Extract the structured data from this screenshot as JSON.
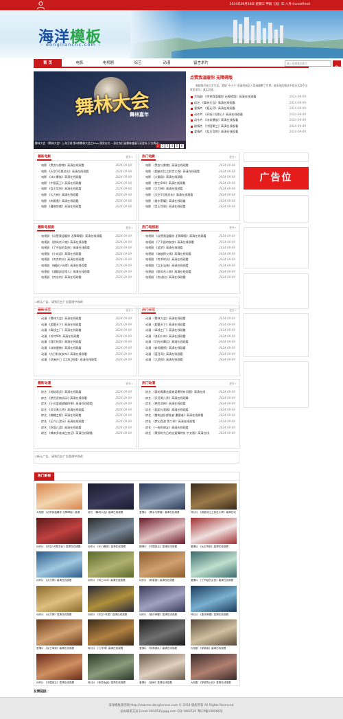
{
  "topbar": {
    "date_text": "2024年09月18日 星期三 甲辰【龙】年 八月十undefined",
    "user_icon": "user-icon",
    "bg": "#c81a1a"
  },
  "header": {
    "logo_part1": "海洋",
    "logo_part2": "模板",
    "domain": "- dongliancnc.com -"
  },
  "nav": {
    "items": [
      "首 页",
      "电影",
      "电视剧",
      "综艺",
      "动漫",
      "留言求片"
    ],
    "active": 0,
    "search_placeholder": "输入你想看的影片",
    "search_icon": "search-icon"
  },
  "banner": {
    "caption": "舞林大会  《舞林大会》上海卫视 第8期舞林大会之Miss 颁奖仪式 一身红衣打造舞林盛宴闪亮登场 只为舞动...",
    "title_art": "舞林大会",
    "sub_art": "舞林嘉年",
    "dots": [
      "1",
      "2",
      "3",
      "4",
      "5",
      "6"
    ],
    "active_dot": 0
  },
  "hot": {
    "title": "点赞我温暖你 无障碍版",
    "desc": "美剧简开始大学生涯。就被“不小子”圣诞的街区人用画翻覆了世界。被未地而情浓不穿无法穿不当家里很可。真实其他...",
    "items": [
      {
        "text": "大陆剧 《余把我温暖你 无障碍版》高清在线观看",
        "date": "2024-09-09"
      },
      {
        "text": "综艺 《舞林大会》高清在线观看",
        "date": "2024-09-09"
      },
      {
        "text": "爱情片 《爱无尽》高清在线观看",
        "date": "2024-09-09"
      },
      {
        "text": "动作片 《开始1号愿心》高清在线观看",
        "date": "2024-09-09"
      },
      {
        "text": "动作片 《冰封暴族》高清在线观看",
        "date": "2024-09-09"
      },
      {
        "text": "剧情片 《中国第三》高清在线观看",
        "date": "2024-09-09"
      },
      {
        "text": "爱情片 《女王驾到》高清在线观看",
        "date": "2024-09-09"
      }
    ]
  },
  "more_label": "更多+",
  "ad_text": "新认广告，请到后台广告管理中修改",
  "ad_position": "广告位",
  "box_latest_movie": {
    "title": "最新电影",
    "items": [
      {
        "text": "电影 《黑女与野兽》高清在线观看",
        "date": "2024-09-08"
      },
      {
        "text": "电影 《天空1号愿总化》高清在线观看",
        "date": "2024-09-08"
      },
      {
        "text": "电影 《冰川暴族》高清在线观看",
        "date": "2024-09-08"
      },
      {
        "text": "电影 《中国英王》高清在线观看",
        "date": "2024-09-08"
      },
      {
        "text": "电影 《女王驾到》高清在线观看",
        "date": "2024-09-08"
      },
      {
        "text": "电影 《大力神》高清在线观看",
        "date": "2024-09-08"
      },
      {
        "text": "电影 《刺客奥》高清在线观看",
        "date": "2024-09-08"
      },
      {
        "text": "电影 《暮夜惊魂》高清在线观看",
        "date": "2024-09-08"
      }
    ]
  },
  "box_hot_movie": {
    "title": "热门电影",
    "items": [
      {
        "text": "电影 《黑女与野兽》高清在线观看",
        "date": "2024-09-08"
      },
      {
        "text": "电影 《超越对比之前世大哥》高清在线观看",
        "date": "2024-09-08"
      },
      {
        "text": "电影 《大翻身》高清在线观看",
        "date": "2024-09-08"
      },
      {
        "text": "电影 《特工008》高清在线观看",
        "date": "2024-09-08"
      },
      {
        "text": "电影 《大力神》高清在线观看",
        "date": "2024-09-08"
      },
      {
        "text": "电影 《天空1号愿总化》高清在线观看",
        "date": "2024-09-08"
      },
      {
        "text": "电影 《首尔荣耀》高清在线观看",
        "date": "2024-09-08"
      },
      {
        "text": "电影 《女王驾到》高清在线观看",
        "date": "2024-09-08"
      }
    ]
  },
  "box_latest_tv": {
    "title": "最新电视剧",
    "items": [
      {
        "text": "电视剧 《点赞我温暖你 无障碍版》高清在线观看",
        "date": "2024-09-09"
      },
      {
        "text": "电视剧 《欧风杰人物》高清在线观看",
        "date": "2024-09-09"
      },
      {
        "text": "电视剧 《了不起的女侠》高清在线观看",
        "date": "2024-09-09"
      },
      {
        "text": "电视剧 《小欢迎》高清在线观看",
        "date": "2024-09-09"
      },
      {
        "text": "电视剧 《杰克的光》高清在线观看",
        "date": "2024-09-09"
      },
      {
        "text": "电视剧 《蛹缺少天使》高清在线观看",
        "date": "2024-09-09"
      },
      {
        "text": "电视剧 《潘都部会馆儿》高清在线观看",
        "date": "2024-09-09"
      },
      {
        "text": "电视剧 《传吉利》高清在线观看",
        "date": "2024-09-09"
      }
    ]
  },
  "box_hot_tv": {
    "title": "热门电视剧",
    "items": [
      {
        "text": "电视剧 《点赞我温暖你 无障碍版》高清在线观看",
        "date": "2024-09-09"
      },
      {
        "text": "电视剧 《了不起的女侠》高清在线观看",
        "date": "2024-09-09"
      },
      {
        "text": "电视剧 《追梦》高清在线观看",
        "date": "2024-09-09"
      },
      {
        "text": "电视剧 《穿越探火线》高清在线观看",
        "date": "2024-09-09"
      },
      {
        "text": "电视剧 《传术的光》高清在线观看",
        "date": "2024-09-09"
      },
      {
        "text": "电视剧 《立水当香》高清在线观看",
        "date": "2024-09-09"
      },
      {
        "text": "电视剧 《欧风杰人物》高清在线观看",
        "date": "2024-09-09"
      },
      {
        "text": "电视剧 《杰成化》高清在线观看",
        "date": "2024-09-09"
      }
    ]
  },
  "box_latest_variety": {
    "title": "最新综艺",
    "items": [
      {
        "text": "动漫 《舞林大会》高清在线观看",
        "date": "2024-09-09"
      },
      {
        "text": "动漫 《超量天下》高清在线观看",
        "date": "2024-09-09"
      },
      {
        "text": "动漫 《离线工厂》高清在线观看",
        "date": "2024-09-09"
      },
      {
        "text": "动漫 《对付99》高清在线观看",
        "date": "2024-09-09"
      },
      {
        "text": "动漫 《我们的家》高清在线观看",
        "date": "2024-09-09"
      },
      {
        "text": "动漫 《非常健教》高清在线观看",
        "date": "2024-09-09"
      },
      {
        "text": "动漫 《大仔科技发布》高清在线观看",
        "date": "2024-09-09"
      },
      {
        "text": "动漫 《芝麻开门【江苏卫视】》高清在线观看",
        "date": "2024-09-09"
      }
    ]
  },
  "box_hot_variety": {
    "title": "热门综艺",
    "items": [
      {
        "text": "动漫 《舞林大会》高清在线观看",
        "date": "2024-09-09"
      },
      {
        "text": "动漫 《超量天下》高清在线观看",
        "date": "2024-09-09"
      },
      {
        "text": "动漫 《离线工厂》高清在线观看",
        "date": "2024-09-09"
      },
      {
        "text": "动漫 《洛阳少林》高清在线观看",
        "date": "2024-09-09"
      },
      {
        "text": "动漫 《闪光的幕后》高清在线观看",
        "date": "2024-09-09"
      },
      {
        "text": "动漫 《新闻雅频》高清在线观看",
        "date": "2024-09-09"
      },
      {
        "text": "动漫 《蓝月亮》高清在线观看",
        "date": "2024-09-09"
      },
      {
        "text": "动漫 《大侦探》高清在线观看",
        "date": "2024-09-09"
      }
    ]
  },
  "box_latest_anime": {
    "title": "最新动漫",
    "items": [
      {
        "text": "综艺 《地狱君武》高清在线观看",
        "date": "2024-09-09"
      },
      {
        "text": "综艺 《绝世武神仙玩》高清在线观看",
        "date": "2024-09-09"
      },
      {
        "text": "综艺 《小可爱甜甜猫四季》高清在线观看",
        "date": "2024-09-09"
      },
      {
        "text": "综艺 《贝贝勇儿秀》高清在线观看",
        "date": "2024-09-09"
      },
      {
        "text": "综艺 《蝴蝶工程》高清在线观看",
        "date": "2024-09-09"
      },
      {
        "text": "综艺 《正兴儿游乐》高清在线观看",
        "date": "2024-09-09"
      },
      {
        "text": "综艺 《吃饭儿游》高清在线观看",
        "date": "2024-09-09"
      },
      {
        "text": "综艺 《缘来多者成白宫记》高清在线观看",
        "date": "2024-09-09"
      }
    ]
  },
  "box_hot_anime": {
    "title": "热门动漫",
    "items": [
      {
        "text": "综艺 《我的青春恋爱物语果然有问题》高清在线",
        "date": "2024-09-09"
      },
      {
        "text": "综艺 《贝贝勇儿秀》高清在线观看",
        "date": "2024-09-09"
      },
      {
        "text": "综艺 《绝世武神》高清在线观看",
        "date": "2024-09-09"
      },
      {
        "text": "综艺 《姐姐与我俩》高清在线观看",
        "date": "2024-09-09"
      },
      {
        "text": "综艺 《雷电战队保准者 重要者》高清在线观看",
        "date": "2024-09-09"
      },
      {
        "text": "综艺 《梦幻西游 第二季》高清在线观看",
        "date": "2024-09-09"
      },
      {
        "text": "综艺 《一周的朋友》高清在线观看",
        "date": "2024-09-09"
      },
      {
        "text": "综艺 《果即时力凸的自爱情特技 中文版》高清在线",
        "date": "2024-09-09"
      }
    ]
  },
  "movies_title": "热门影视",
  "movies": [
    {
      "caption": "大陆剧 《点赞我温暖你 无障碍版》高清",
      "c1": "#d9834a",
      "c2": "#f2d6b0"
    },
    {
      "caption": "综艺 《舞林大会》高清在线观看",
      "c1": "#1a1a2e",
      "c2": "#3a3a5a"
    },
    {
      "caption": "爱情片 《黑女与野兽》高清在线观看",
      "c1": "#2a3a5a",
      "c2": "#8a9ab0"
    },
    {
      "caption": "科幻片 《超越对比之前世大哥》高清在线",
      "c1": "#3a2a1a",
      "c2": "#9a7a4a"
    },
    {
      "caption": "动作片 《天空1号愿总化》高清在线观看",
      "c1": "#5a1a1a",
      "c2": "#c04040"
    },
    {
      "caption": "动作片 《冰川暴族》高清在线观看",
      "c1": "#2a2a2a",
      "c2": "#7a8a9a"
    },
    {
      "caption": "剧情片 《中国英王》高清在线观看",
      "c1": "#6a1a2a",
      "c2": "#e0c0c0"
    },
    {
      "caption": "爱情片 《女王驾到》高清在线观看",
      "c1": "#a03030",
      "c2": "#f0e0e0"
    },
    {
      "caption": "动作片 《大力神》高清在线观看",
      "c1": "#2a5a8a",
      "c2": "#a0c8e0"
    },
    {
      "caption": "动作片 《特工008》高清在线观看",
      "c1": "#5a6a2a",
      "c2": "#b0b070"
    },
    {
      "caption": "动作片 《刺客奥》高清在线观看",
      "c1": "#8a5a2a",
      "c2": "#d0a070"
    },
    {
      "caption": "爱情片 《了不起的女侠》高清在线观看",
      "c1": "#3a6a6a",
      "c2": "#c0e0d0"
    },
    {
      "caption": "动作片 《大力神》高清在线观看",
      "c1": "#8a6a2a",
      "c2": "#e0c080"
    },
    {
      "caption": "动作片 《天空1号愿》高清在线观看",
      "c1": "#2a2a3a",
      "c2": "#b0903a"
    },
    {
      "caption": "动作片 《首尔荣耀》高清在线观看",
      "c1": "#3a3a5a",
      "c2": "#a0a0c0"
    },
    {
      "caption": "科幻片 《重庆荣耀》高清在线观看",
      "c1": "#1a3a5a",
      "c2": "#7ab0d0"
    },
    {
      "caption": "爱情片 《女王驾到》高清在线观看",
      "c1": "#6a3a1a",
      "c2": "#d0a070"
    },
    {
      "caption": "科幻片 《七号神》高清在线观看",
      "c1": "#3a2a1a",
      "c2": "#b08040"
    },
    {
      "caption": "爱情片 《特殊部队》高清在线观看",
      "c1": "#1a1a1a",
      "c2": "#707070"
    },
    {
      "caption": "大陆剧 《穿越者》高清在线观看",
      "c1": "#5a4a3a",
      "c2": "#d0c0a0"
    },
    {
      "caption": "动作片 《中国英王》高清在线观看",
      "c1": "#6a2a1a",
      "c2": "#d09060"
    },
    {
      "caption": "科幻片 《惊变危途》高清在线观看",
      "c1": "#2a3a2a",
      "c2": "#8a9a7a"
    },
    {
      "caption": "爱情片 《谜局》高清在线观看",
      "c1": "#6a5a4a",
      "c2": "#e0d0c0"
    },
    {
      "caption": "大陆剧 《穿越探火线》高清在线观看",
      "c1": "#3a2a2a",
      "c2": "#b08070"
    }
  ],
  "friend_links": "友情链接：",
  "footer": {
    "line1": "海洋模板演示网 http://seacms.dongliancnc.com © 2018 版权所有 All Rights Reserved.",
    "line2": "站长联系方式 Email:1002535@qq.com QQ:1002535    粤ICP备100086号"
  }
}
